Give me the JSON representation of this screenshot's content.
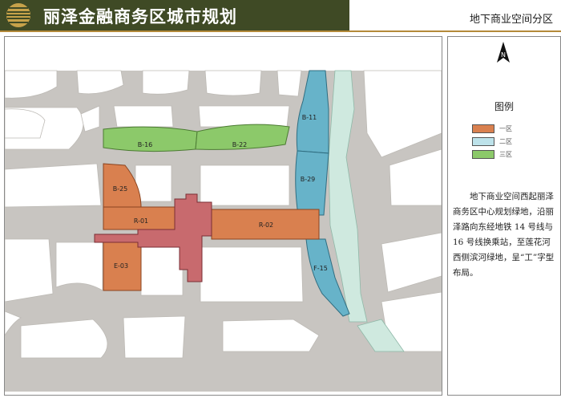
{
  "header": {
    "title": "丽泽金融商务区城市规划",
    "subtitle": "地下商业空间分区"
  },
  "map": {
    "zones": [
      {
        "id": "B-16",
        "group": "三区"
      },
      {
        "id": "B-22",
        "group": "三区"
      },
      {
        "id": "B-11",
        "group": "二区"
      },
      {
        "id": "B-29",
        "group": "二区"
      },
      {
        "id": "F-15",
        "group": "二区"
      },
      {
        "id": "B-25",
        "group": "一区"
      },
      {
        "id": "R-01",
        "group": "一区"
      },
      {
        "id": "R-02",
        "group": "一区"
      },
      {
        "id": "E-03",
        "group": "一区"
      }
    ]
  },
  "legend": {
    "title": "图例",
    "items": [
      {
        "label": "一区",
        "color": "#d9804f"
      },
      {
        "label": "二区",
        "color": "#bde2ea"
      },
      {
        "label": "三区",
        "color": "#8cc96a"
      }
    ],
    "description": "地下商业空间西起丽泽商务区中心规划绿地，沿丽泽路向东经地铁 14 号线与 16 号线换乘站，至莲花河西侧滨河绿地，呈“工”字型布局。"
  },
  "colors": {
    "header_bg": "#3f4a25",
    "road": "#c8c5c1",
    "zone1": "#d9804f",
    "zone2_blue": "#67b3c9",
    "zone2_light": "#bde2ea",
    "zone3": "#8cc96a",
    "station": "#c86a6e",
    "river_green": "#cfe9df"
  },
  "compass": {
    "label": "N"
  }
}
